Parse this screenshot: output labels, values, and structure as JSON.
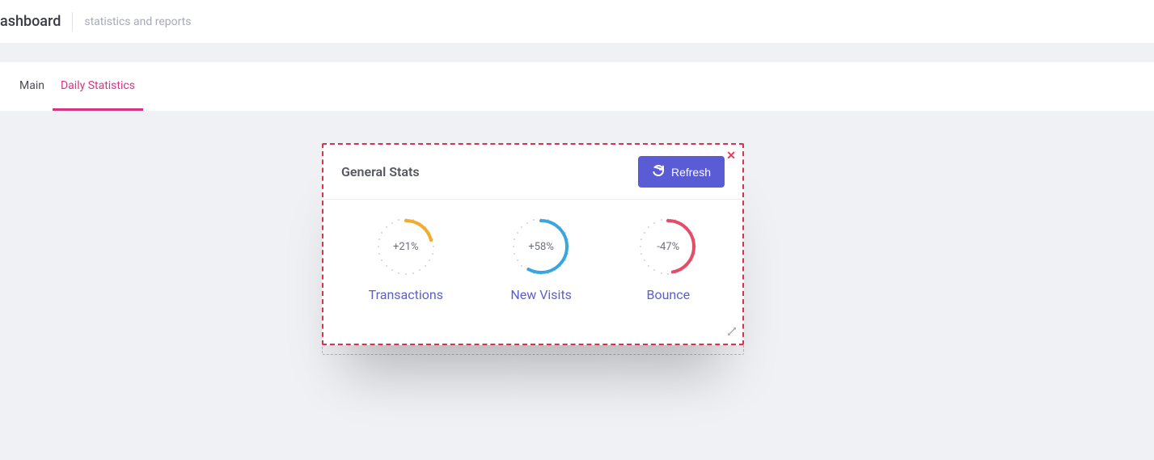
{
  "header": {
    "title": "ashboard",
    "subtitle": "statistics and reports"
  },
  "tabs": [
    {
      "label": "Main",
      "active": false
    },
    {
      "label": "Daily Statistics",
      "active": true
    }
  ],
  "card": {
    "title": "General Stats",
    "refresh_label": "Refresh",
    "stats": [
      {
        "label": "Transactions",
        "value": "+21%",
        "pct": 21,
        "color": "#f0ad2e"
      },
      {
        "label": "New Visits",
        "value": "+58%",
        "pct": 58,
        "color": "#3aa6dd"
      },
      {
        "label": "Bounce",
        "value": "-47%",
        "pct": 47,
        "color": "#e34d68"
      }
    ]
  }
}
